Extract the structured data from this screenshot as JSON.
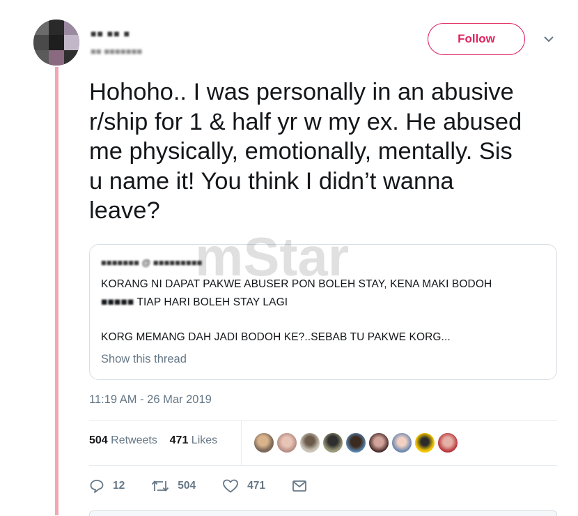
{
  "author": {
    "name_blurred": "■■ ■■ ■",
    "handle_blurred": "■■ ■■■■■■■"
  },
  "follow_label": "Follow",
  "tweet_text": "Hohoho.. I was personally in an abusive\nr/ship for 1 & half yr w my ex. He abused\nme physically, emotionally, mentally. Sis\nu name it! You think I didn’t wanna\nleave?",
  "watermark_text": "mStar",
  "quoted": {
    "author_blurred": "■■■■■■■ @ ■■■■■■■■■",
    "line1": "KORANG NI DAPAT PAKWE ABUSER PON BOLEH STAY,  KENA MAKI BODOH",
    "line2_blurred": "■■■■■",
    "line2": " TIAP HARI BOLEH STAY LAGI",
    "line3": "KORG MEMANG DAH JADI BODOH KE?..SEBAB TU PAKWE KORG...",
    "show_thread": "Show this thread"
  },
  "timestamp": "11:19 AM - 26 Mar 2019",
  "stats": {
    "retweets": "504",
    "retweets_label": "Retweets",
    "likes": "471",
    "likes_label": "Likes"
  },
  "actions": {
    "reply_count": "12",
    "retweet_count": "504",
    "like_count": "471"
  },
  "colors": {
    "accent": "#e0245e",
    "thread_line": "#f2a7b4",
    "muted": "#657786"
  },
  "icons": [
    "chevron-down-icon",
    "reply-icon",
    "retweet-icon",
    "heart-icon",
    "envelope-icon"
  ]
}
